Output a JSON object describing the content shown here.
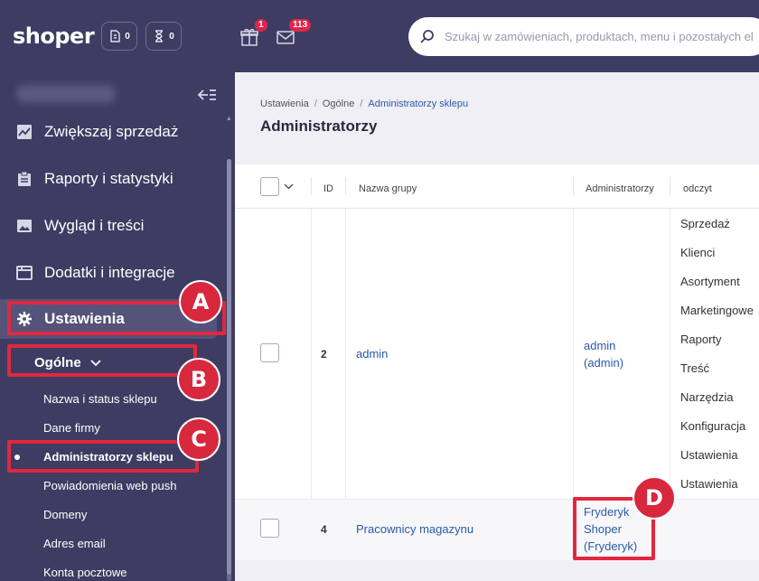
{
  "topbar": {
    "logo": "shoper",
    "counter1": "0",
    "counter2": "0",
    "gift_badge": "1",
    "mail_badge": "113",
    "search_placeholder": "Szukaj w zamówieniach, produktach, menu i pozostałych el"
  },
  "sidebar": {
    "items": [
      {
        "label": "Zwiększaj sprzedaż",
        "icon": "trend-chart-icon"
      },
      {
        "label": "Raporty i statystyki",
        "icon": "clipboard-icon"
      },
      {
        "label": "Wygląd i treści",
        "icon": "image-icon"
      },
      {
        "label": "Dodatki i integracje",
        "icon": "puzzle-window-icon"
      },
      {
        "label": "Ustawienia",
        "icon": "gear-icon"
      }
    ],
    "submenu_head": "Ogólne",
    "sub_items": [
      "Nazwa i status sklepu",
      "Dane firmy",
      "Administratorzy sklepu",
      "Powiadomienia web push",
      "Domeny",
      "Adres email",
      "Konta pocztowe"
    ]
  },
  "annotations": {
    "a": "A",
    "b": "B",
    "c": "C",
    "d": "D"
  },
  "breadcrumb": {
    "crumb1": "Ustawienia",
    "crumb2": "Ogólne",
    "crumb3": "Administratorzy sklepu",
    "sep": "/"
  },
  "page_title": "Administratorzy",
  "table": {
    "headers": {
      "id": "ID",
      "name": "Nazwa grupy",
      "admins": "Administratorzy",
      "read": "odczyt"
    },
    "rows": [
      {
        "id": "2",
        "name": "admin",
        "admins": [
          "admin",
          "(admin)"
        ],
        "permissions": [
          "Sprzedaż",
          "Klienci",
          "Asortyment",
          "Marketingowe",
          "Raporty",
          "Treść",
          "Narzędzia",
          "Konfiguracja",
          "Ustawienia",
          "Ustawienia"
        ]
      },
      {
        "id": "4",
        "name": "Pracownicy magazynu",
        "admins": [
          "Fryderyk",
          "Shoper",
          "(Fryderyk)"
        ],
        "permissions": []
      }
    ]
  },
  "colors": {
    "sidebar": "#3e3c62",
    "accent_link": "#2b5aa6",
    "annotation": "#e0283f",
    "badge": "#e0254a"
  }
}
